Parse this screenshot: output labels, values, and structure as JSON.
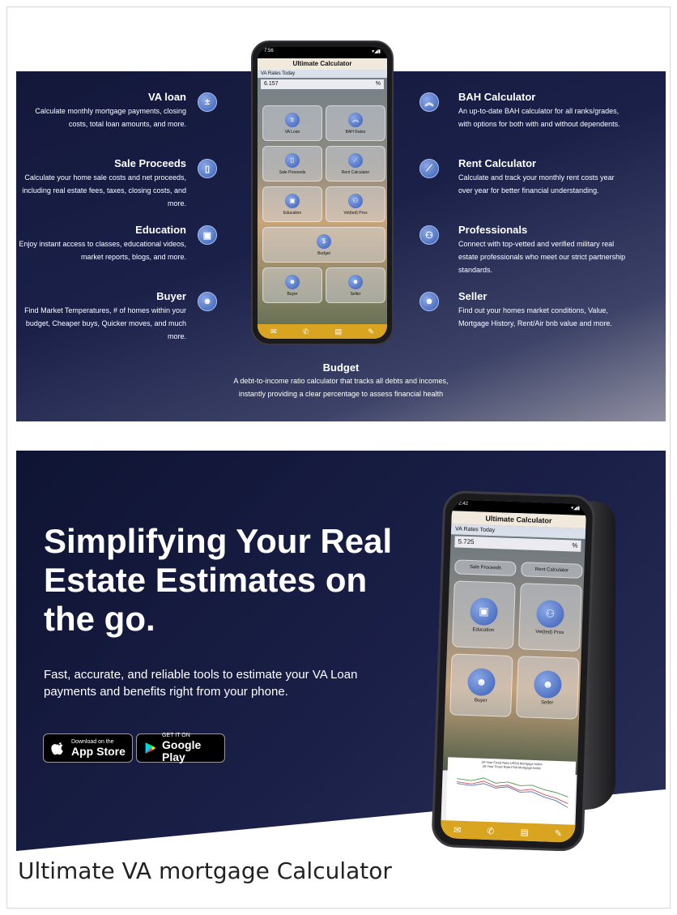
{
  "panel1": {
    "features_left": [
      {
        "title": "VA loan",
        "desc": "Calculate monthly mortgage payments, closing costs, total loan amounts, and more.",
        "icon": "calculator-icon"
      },
      {
        "title": "Sale Proceeds",
        "desc": "Calculate your home sale costs and net proceeds, including real estate fees, taxes, closing costs, and more.",
        "icon": "sale-proceeds-icon"
      },
      {
        "title": "Education",
        "desc": "Enjoy instant access to classes, educational videos, market reports, blogs, and more.",
        "icon": "education-icon"
      },
      {
        "title": "Buyer",
        "desc": "Find Market Temperatures, # of homes within your budget, Cheaper buys, Quicker moves, and much more.",
        "icon": "robot-icon"
      }
    ],
    "features_right": [
      {
        "title": "BAH Calculator",
        "desc": "An up-to-date BAH calculator for all ranks/grades, with options for both with and without dependents.",
        "icon": "chevron-rank-icon"
      },
      {
        "title": "Rent Calculator",
        "desc": "Calculate and track your monthly rent costs year over year for better financial understanding.",
        "icon": "chart-icon"
      },
      {
        "title": "Professionals",
        "desc": "Connect with top-vetted and verified military real estate professionals who meet our strict partnership standards.",
        "icon": "people-icon"
      },
      {
        "title": "Seller",
        "desc": "Find out your homes market conditions, Value, Mortgage History, Rent/Air bnb value and more.",
        "icon": "robot-icon"
      }
    ],
    "budget": {
      "title": "Budget",
      "desc": "A debt-to-income ratio calculator that tracks all debts and incomes, instantly providing a clear percentage to assess financial health"
    },
    "phone": {
      "status_time": "7:56",
      "app_title": "Ultimate Calculator",
      "rates_label": "VA Rates Today",
      "rate_value": "6.157",
      "percent": "%",
      "tiles": [
        "VA Loan",
        "BAH Rates",
        "Sale Proceeds",
        "Rent Calculator",
        "Education",
        "Vet(ted) Pros",
        "Budget",
        "Buyer",
        "Seller"
      ]
    }
  },
  "panel2": {
    "headline": "Simplifying Your Real Estate Estimates on the go.",
    "subline": "Fast, accurate, and reliable tools to estimate your VA Loan payments and benefits right from your phone.",
    "appstore": {
      "small": "Download on the",
      "big": "App Store"
    },
    "googleplay": {
      "small": "GET IT ON",
      "big": "Google Play"
    },
    "phone": {
      "status_time": "2:42",
      "app_title": "Ultimate Calculator",
      "rates_label": "VA Rates Today",
      "rate_value": "5.725",
      "percent": "%",
      "tiles": [
        "Sale Proceeds",
        "Rent Calculator",
        "Education",
        "Vet(ted) Pros",
        "Buyer",
        "Seller"
      ],
      "chart_legend": [
        "30-Year Fixed Rate USDA Mortgage Index",
        "30-Year Fixed Rate FHA Mortgage Index"
      ],
      "chart_ylabel": "Percent"
    }
  },
  "caption": "Ultimate VA mortgage Calculator",
  "colors": {
    "navy": "#13183a",
    "accent_blue": "#3a5db5",
    "gold_bar": "#d9a520"
  }
}
